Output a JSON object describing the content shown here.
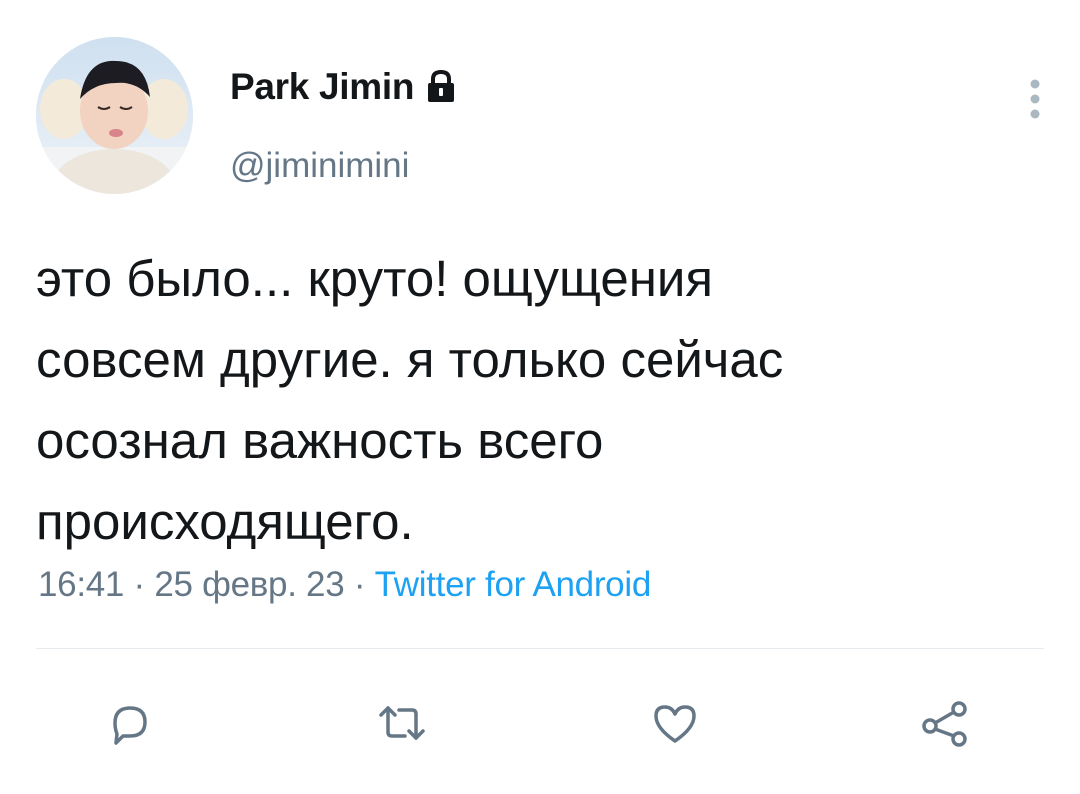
{
  "user": {
    "display_name": "Park Jimin",
    "handle": "@jiminimini",
    "protected_icon": "lock-icon",
    "avatar": "profile-photo"
  },
  "tweet": {
    "lines": [
      "это было... круто! ощущения",
      "совсем другие. я только сейчас",
      "осознал важность всего",
      "происходящего."
    ],
    "time": "16:41",
    "date": "25 февр. 23",
    "separator": "·",
    "source": "Twitter for Android"
  },
  "actions": [
    "reply-icon",
    "retweet-icon",
    "like-icon",
    "share-icon"
  ],
  "colors": {
    "text": "#14171a",
    "secondary": "#657786",
    "accent": "#1da1f2",
    "divider": "#e6ecf0"
  }
}
